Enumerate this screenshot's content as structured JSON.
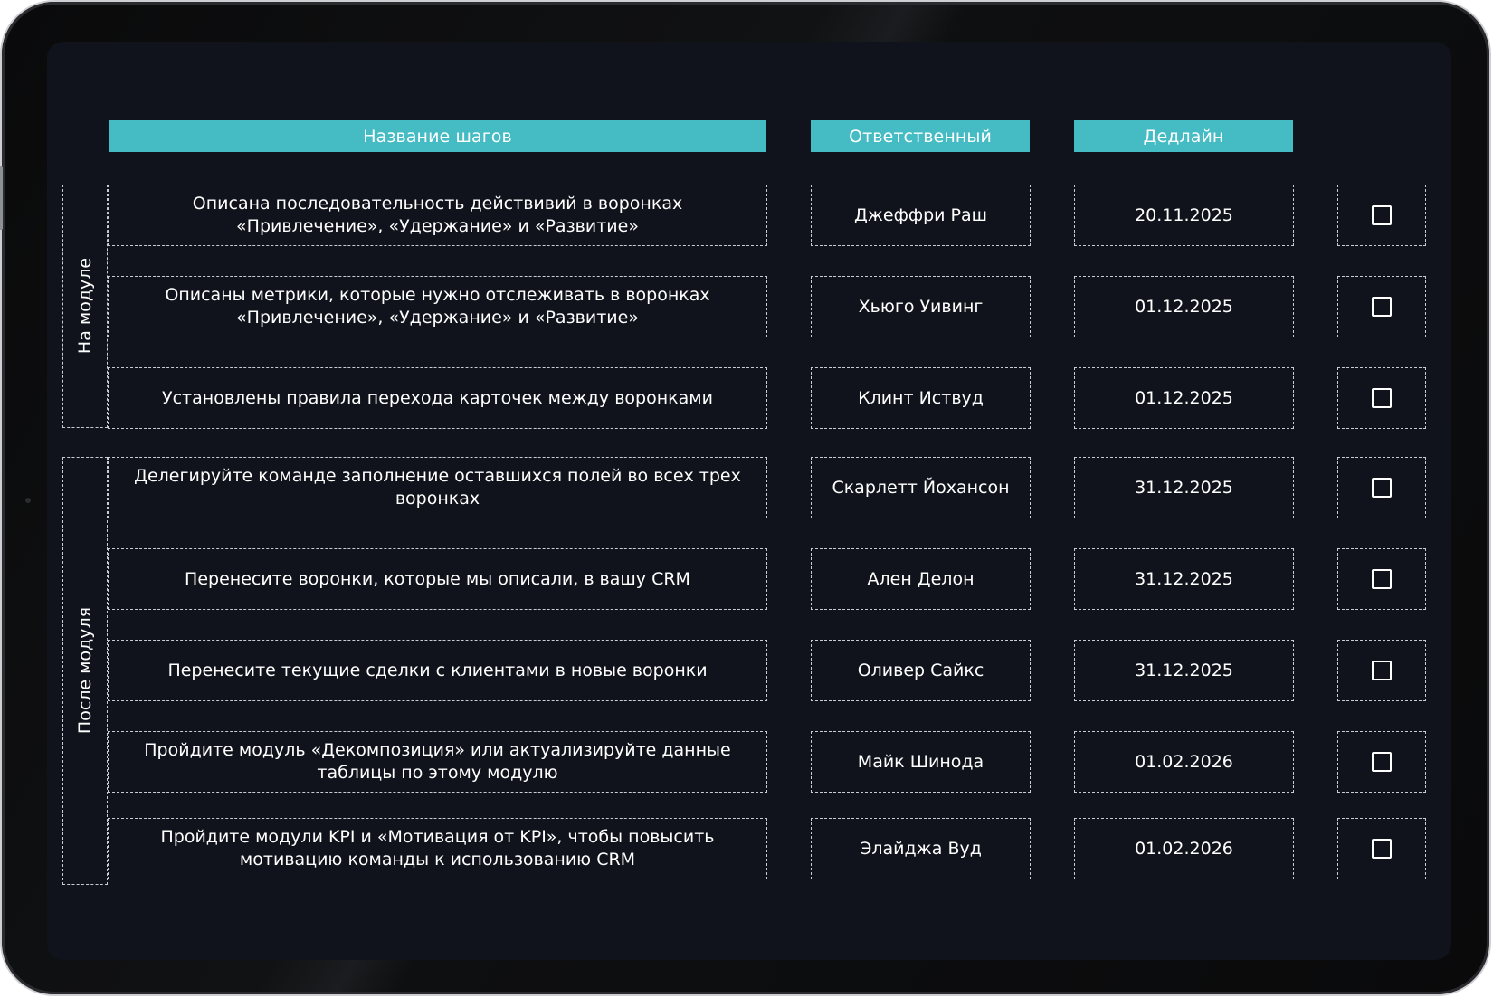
{
  "headers": {
    "steps": "Название шагов",
    "owner": "Ответственный",
    "deadline": "Дедлайн"
  },
  "groups": [
    {
      "label": "На модуле"
    },
    {
      "label": "После модуля"
    }
  ],
  "rows": [
    {
      "step": "Описана последовательность действивий в воронках «Привлечение», «Удержание» и «Развитие»",
      "owner": "Джеффри Раш",
      "deadline": "20.11.2025",
      "checked": false
    },
    {
      "step": "Описаны метрики, которые нужно отслеживать в воронках «Привлечение», «Удержание» и «Развитие»",
      "owner": "Хьюго Уивинг",
      "deadline": "01.12.2025",
      "checked": false
    },
    {
      "step": "Установлены правила перехода карточек между воронками",
      "owner": "Клинт Иствуд",
      "deadline": "01.12.2025",
      "checked": false
    },
    {
      "step": "Делегируйте команде заполнение оставшихся полей во всех трех воронках",
      "owner": "Скарлетт Йохансон",
      "deadline": "31.12.2025",
      "checked": false
    },
    {
      "step": "Перенесите воронки, которые мы описали, в вашу CRM",
      "owner": "Ален Делон",
      "deadline": "31.12.2025",
      "checked": false
    },
    {
      "step": "Перенесите текущие сделки с клиентами в новые воронки",
      "owner": "Оливер Сайкс",
      "deadline": "31.12.2025",
      "checked": false
    },
    {
      "step": "Пройдите модуль «Декомпозиция» или актуализируйте данные таблицы по этому модулю",
      "owner": "Майк Шинода",
      "deadline": "01.02.2026",
      "checked": false
    },
    {
      "step": "Пройдите модули KPI и «Мотивация от KPI», чтобы повысить мотивацию команды к использованию CRM",
      "owner": "Элайджа Вуд",
      "deadline": "01.02.2026",
      "checked": false
    }
  ]
}
